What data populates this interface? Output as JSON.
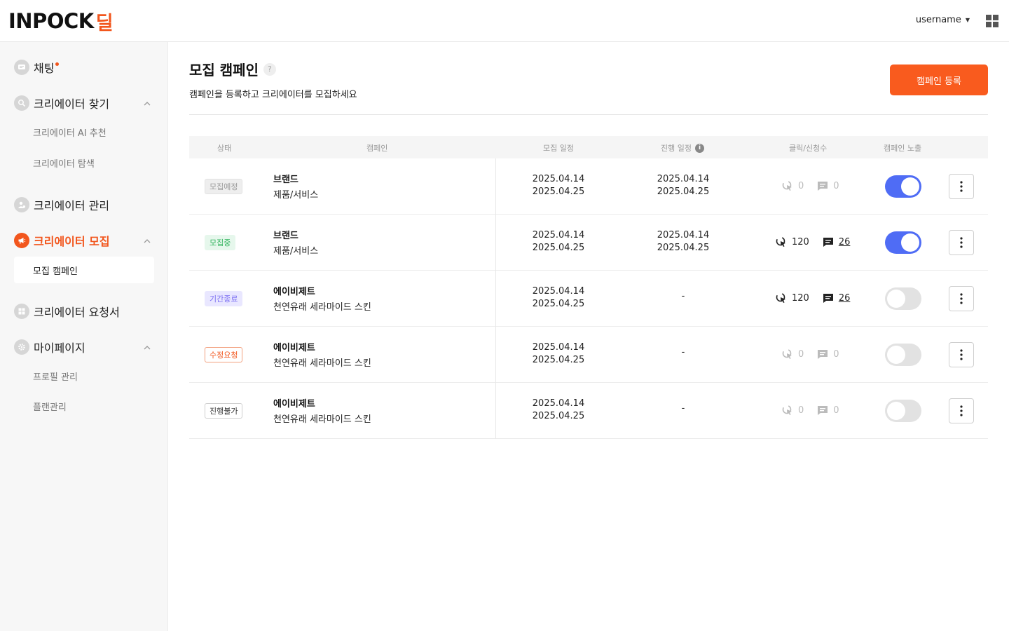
{
  "header": {
    "logo_text": "INPOCK",
    "logo_accent": "딜",
    "username": "username",
    "apps_icon": "grid-icon"
  },
  "sidebar": {
    "chat": {
      "label": "채팅",
      "icon": "chat-icon"
    },
    "find_creator": {
      "label": "크리에이터 찾기",
      "icon": "search-icon",
      "subs": [
        "크리에이터 AI 추천",
        "크리에이터 탐색"
      ]
    },
    "manage_creator": {
      "label": "크리에이터 관리",
      "icon": "people-icon"
    },
    "recruit_creator": {
      "label": "크리에이터 모집",
      "icon": "megaphone-icon",
      "subs": [
        "모집 캠페인"
      ]
    },
    "request_creator": {
      "label": "크리에이터 요청서",
      "icon": "grid-icon"
    },
    "mypage": {
      "label": "마이페이지",
      "icon": "gear-icon",
      "subs": [
        "프로필 관리",
        "플랜관리"
      ]
    }
  },
  "main": {
    "title": "모집 캠페인",
    "help": "?",
    "description": "캠페인을 등록하고 크리에이터를 모집하세요",
    "register_button": "캠페인 등록"
  },
  "table": {
    "headers": {
      "status": "상태",
      "campaign": "캠페인",
      "recruit_period": "모집 일정",
      "progress_period": "진행 일정",
      "clicks_applies": "클릭/신청수",
      "exposure": "캠페인 노출"
    },
    "info_icon": "i",
    "rows": [
      {
        "status": "모집예정",
        "brand": "브랜드",
        "product": "제품/서비스",
        "recruit_start": "2025.04.14",
        "recruit_end": "2025.04.25",
        "progress_start": "2025.04.14",
        "progress_end": "2025.04.25",
        "clicks": "0",
        "applies": "0",
        "exposure_on": true
      },
      {
        "status": "모집중",
        "brand": "브랜드",
        "product": "제품/서비스",
        "recruit_start": "2025.04.14",
        "recruit_end": "2025.04.25",
        "progress_start": "2025.04.14",
        "progress_end": "2025.04.25",
        "clicks": "120",
        "applies": "26",
        "exposure_on": true
      },
      {
        "status": "기간종료",
        "brand": "에이비제트",
        "product": "천연유래 세라마이드 스킨",
        "recruit_start": "2025.04.14",
        "recruit_end": "2025.04.25",
        "progress": "-",
        "clicks": "120",
        "applies": "26",
        "exposure_on": false
      },
      {
        "status": "수정요청",
        "brand": "에이비제트",
        "product": "천연유래 세라마이드 스킨",
        "recruit_start": "2025.04.14",
        "recruit_end": "2025.04.25",
        "progress": "-",
        "clicks": "0",
        "applies": "0",
        "exposure_on": false
      },
      {
        "status": "진행불가",
        "brand": "에이비제트",
        "product": "천연유래 세라마이드 스킨",
        "recruit_start": "2025.04.14",
        "recruit_end": "2025.04.25",
        "progress": "-",
        "clicks": "0",
        "applies": "0",
        "exposure_on": false
      }
    ]
  },
  "colors": {
    "accent": "#f95b1e",
    "toggle_on": "#4f6cf5",
    "toggle_off": "#e2e2e2"
  }
}
